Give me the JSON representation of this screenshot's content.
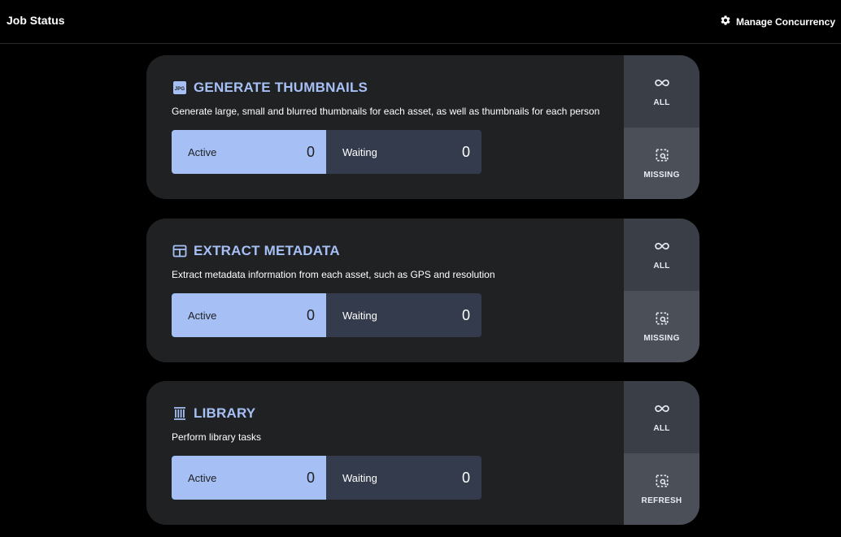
{
  "header": {
    "title": "Job Status",
    "concurrency_label": "Manage Concurrency",
    "concurrency_icon": "gear-icon"
  },
  "colors": {
    "accent": "#a6c0f5",
    "card_bg": "#202123",
    "waiting_bg": "#343b4d",
    "background": "#000000"
  },
  "jobs": [
    {
      "title": "GENERATE THUMBNAILS",
      "icon": "jpg-file-icon",
      "description": "Generate large, small and blurred thumbnails for each asset, as well as thumbnails for each person",
      "active_label": "Active",
      "active_count": "0",
      "waiting_label": "Waiting",
      "waiting_count": "0",
      "action_all_label": "ALL",
      "action_second_label": "MISSING"
    },
    {
      "title": "EXTRACT METADATA",
      "icon": "table-icon",
      "description": "Extract metadata information from each asset, such as GPS and resolution",
      "active_label": "Active",
      "active_count": "0",
      "waiting_label": "Waiting",
      "waiting_count": "0",
      "action_all_label": "ALL",
      "action_second_label": "MISSING"
    },
    {
      "title": "LIBRARY",
      "icon": "library-shelves-icon",
      "description": "Perform library tasks",
      "active_label": "Active",
      "active_count": "0",
      "waiting_label": "Waiting",
      "waiting_count": "0",
      "action_all_label": "ALL",
      "action_second_label": "REFRESH"
    }
  ]
}
